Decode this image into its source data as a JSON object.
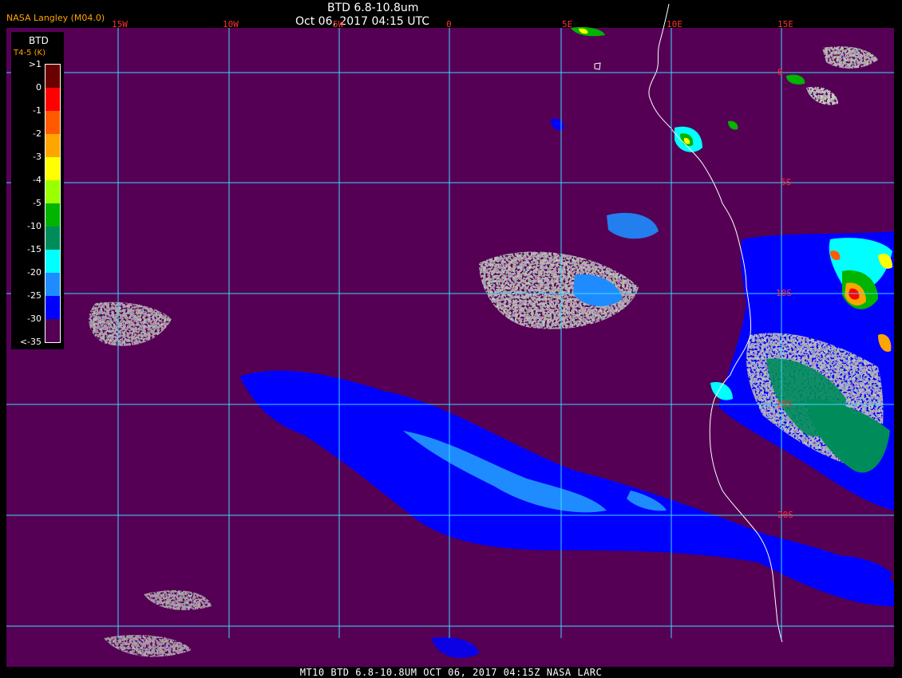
{
  "header": {
    "credit": "NASA Langley (M04.0)",
    "title": "BTD 6.8-10.8um",
    "subtitle": "Oct 06, 2017 04:15 UTC"
  },
  "footer": "MT10  BTD 6.8-10.8UM  OCT 06, 2017 04:15Z  NASA LARC",
  "legend": {
    "title": "BTD",
    "subtitle": "T4-5 (K)",
    "labels": [
      ">1",
      "0",
      "-1",
      "-2",
      "-3",
      "-4",
      "-5",
      "-10",
      "-15",
      "-20",
      "-25",
      "-30",
      "<-35"
    ],
    "colors": [
      "#6b0000",
      "#ff0000",
      "#ff5a00",
      "#ffa500",
      "#ffff00",
      "#9aff00",
      "#00b400",
      "#008c5a",
      "#00ffff",
      "#1e8cff",
      "#0000ff",
      "#550055"
    ]
  },
  "grid": {
    "longitude_labels": [
      "15W",
      "10W",
      "5W",
      "0",
      "5E",
      "10E",
      "15E"
    ],
    "latitude_labels": [
      "0",
      "5S",
      "10S",
      "15S",
      "20S"
    ],
    "line_color": "#40d8ff"
  },
  "colors": {
    "background": "#550055",
    "coastline": "#ffffff",
    "label_red": "#ff3030"
  }
}
